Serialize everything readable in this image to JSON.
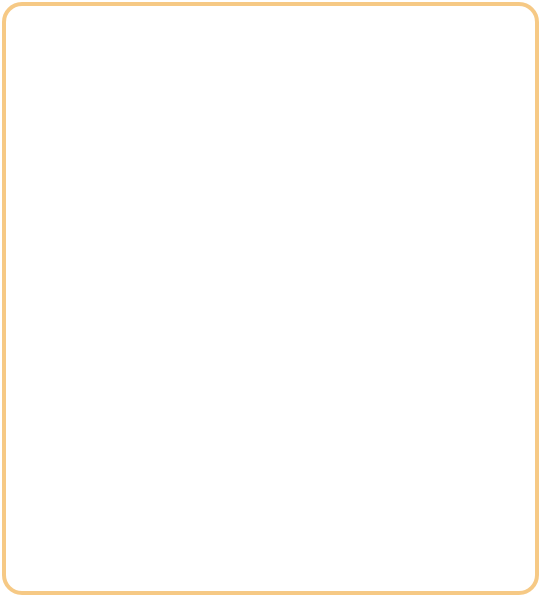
{
  "panel": {
    "border_color": "#f6c985",
    "background_color": "#ffffff"
  }
}
